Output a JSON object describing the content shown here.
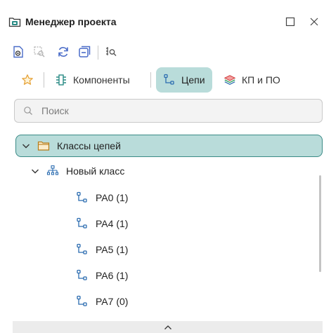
{
  "panel": {
    "title": "Менеджер проекта",
    "title_icon": "project-folder-icon",
    "maximize_icon": "maximize-icon",
    "close_icon": "close-icon"
  },
  "toolbar": {
    "icons": [
      "view-document-icon",
      "zoom-selection-icon",
      "refresh-icon",
      "collapse-all-icon",
      "find-icon"
    ]
  },
  "tabs": [
    {
      "label": "",
      "icon": "star-icon",
      "active": false
    },
    {
      "label": "Компоненты",
      "icon": "component-icon",
      "active": false
    },
    {
      "label": "Цепи",
      "icon": "net-icon",
      "active": true
    },
    {
      "label": "КП и ПО",
      "icon": "layers-icon",
      "active": false
    }
  ],
  "search": {
    "placeholder": "Поиск",
    "value": ""
  },
  "tree": {
    "root": {
      "label": "Классы цепей",
      "icon": "folder-icon",
      "expanded": true
    },
    "group": {
      "label": "Новый класс",
      "icon": "hierarchy-icon",
      "expanded": true
    },
    "items": [
      {
        "label": "PA0 (1)",
        "icon": "net-icon"
      },
      {
        "label": "PA4 (1)",
        "icon": "net-icon"
      },
      {
        "label": "PA5 (1)",
        "icon": "net-icon"
      },
      {
        "label": "PA6 (1)",
        "icon": "net-icon"
      },
      {
        "label": "PA7 (0)",
        "icon": "net-icon"
      }
    ]
  },
  "colors": {
    "accent": "#b9dcda",
    "accent_border": "#3a8a86",
    "icon_blue": "#4a6cc8",
    "icon_teal": "#2b8c86",
    "star_orange": "#e6a33a",
    "folder_yellow": "#e0a63c"
  }
}
